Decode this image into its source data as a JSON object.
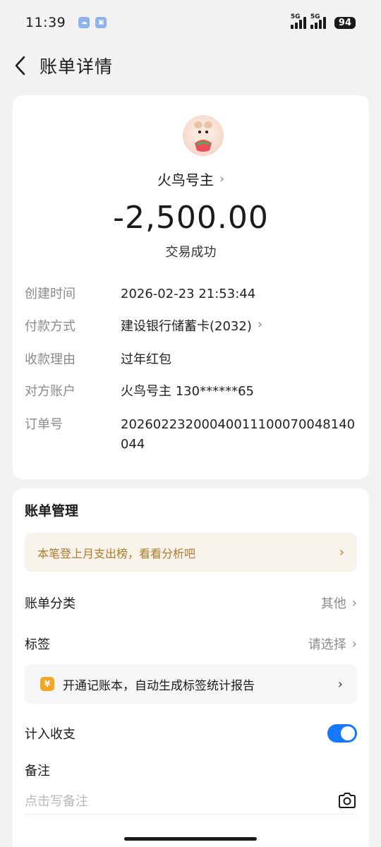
{
  "status_bar": {
    "time": "11:39",
    "network_1": "5G",
    "network_2": "5G",
    "battery": "94"
  },
  "nav": {
    "title": "账单详情"
  },
  "summary": {
    "payee": "火鸟号主",
    "amount": "-2,500.00",
    "status": "交易成功"
  },
  "details": [
    {
      "label": "创建时间",
      "value": "2026-02-23 21:53:44"
    },
    {
      "label": "付款方式",
      "value": "建设银行储蓄卡(2032)"
    },
    {
      "label": "收款理由",
      "value": "过年红包"
    },
    {
      "label": "对方账户",
      "value": "火鸟号主 130******65"
    },
    {
      "label": "订单号",
      "value": "20260223200040011100070048140044"
    }
  ],
  "management": {
    "title": "账单管理",
    "banner": "本笔登上月支出榜，看看分析吧",
    "category_label": "账单分类",
    "category_value": "其他",
    "tag_label": "标签",
    "tag_value": "请选择",
    "promo_text": "开通记账本，自动生成标签统计报告",
    "promo_icon_glyph": "¥",
    "income_expense_label": "计入收支",
    "income_expense_enabled": true,
    "remark_label": "备注",
    "remark_placeholder": "点击写备注"
  },
  "colors": {
    "accent": "#1677ff",
    "banner_text": "#b07a2a",
    "banner_bg": "#f8f3ea"
  }
}
